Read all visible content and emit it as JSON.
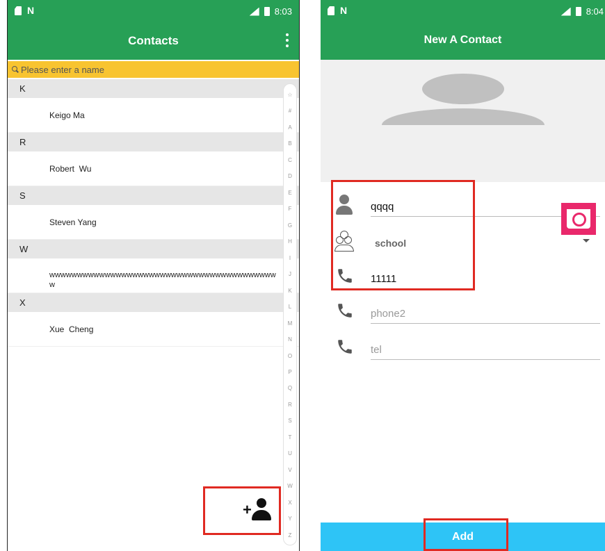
{
  "left": {
    "status": {
      "time": "8:03"
    },
    "toolbar": {
      "title": "Contacts"
    },
    "search": {
      "placeholder": "Please enter a name"
    },
    "sections": [
      {
        "letter": "K",
        "contacts": [
          "Keigo Ma"
        ]
      },
      {
        "letter": "R",
        "contacts": [
          "Robert  Wu"
        ]
      },
      {
        "letter": "S",
        "contacts": [
          "Steven Yang"
        ]
      },
      {
        "letter": "W",
        "contacts": [
          "wwwwwwwwwwwwwwwwwwwwwwwwwwwwwwwwwwwwwwwwww"
        ]
      },
      {
        "letter": "X",
        "contacts": [
          "Xue  Cheng"
        ]
      }
    ],
    "index_letters": [
      "☆",
      "#",
      "A",
      "B",
      "C",
      "D",
      "E",
      "F",
      "G",
      "H",
      "I",
      "J",
      "K",
      "L",
      "M",
      "N",
      "O",
      "P",
      "Q",
      "R",
      "S",
      "T",
      "U",
      "V",
      "W",
      "X",
      "Y",
      "Z"
    ]
  },
  "right": {
    "status": {
      "time": "8:04"
    },
    "toolbar": {
      "title": "New A Contact"
    },
    "form": {
      "name_value": "qqqq",
      "group_value": "school",
      "phone1_value": "11111",
      "phone2_placeholder": "phone2",
      "tel_placeholder": "tel"
    },
    "add_label": "Add"
  },
  "colors": {
    "primary_green": "#27a056",
    "search_yellow": "#f8c430",
    "camera_pink": "#e9286b",
    "add_blue": "#2ec4f6",
    "highlight_red": "#e02a22"
  }
}
